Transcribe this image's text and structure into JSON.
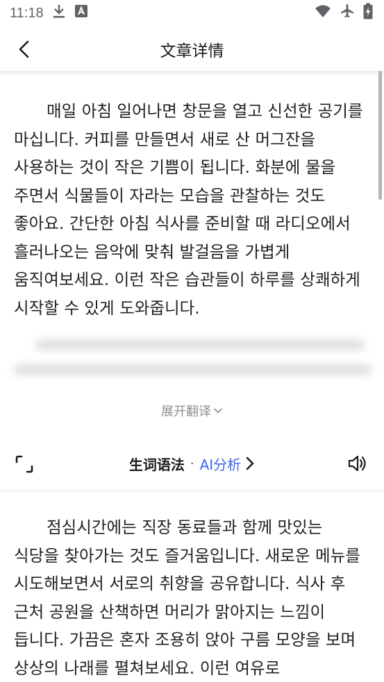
{
  "status_bar": {
    "time": "11:18",
    "icons_left": [
      "download-icon",
      "a-app-icon"
    ],
    "icons_right": [
      "wifi-icon",
      "airplane-mode-icon",
      "battery-charging-icon"
    ]
  },
  "header": {
    "title": "文章详情",
    "back_icon": "chevron-left-icon"
  },
  "article": {
    "paragraph_1": "매일 아침 일어나면 창문을 열고 신선한 공기를 마십니다. 커피를 만들면서 새로 산 머그잔을 사용하는 것이 작은 기쁨이 됩니다. 화분에 물을 주면서 식물들이 자라는 모습을 관찰하는 것도 좋아요. 간단한 아침 식사를 준비할 때 라디오에서 흘러나오는 음악에 맞춰 발걸음을 가볍게 움직여보세요. 이런 작은 습관들이 하루를 상쾌하게 시작할 수 있게 도와줍니다.",
    "paragraph_2": "점심시간에는 직장 동료들과 함께 맛있는 식당을 찾아가는 것도 즐거움입니다. 새로운 메뉴를 시도해보면서 서로의 취향을 공유합니다. 식사 후 근처 공원을 산책하면 머리가 맑아지는 느낌이 듭니다. 가끔은 혼자 조용히 앉아 구름 모양을 보며 상상의 나래를 펼쳐보세요. 이런 여유로"
  },
  "translation": {
    "expand_label": "展开翻译",
    "expand_icon": "chevron-down-icon"
  },
  "toolbar": {
    "vocab_label": "生词语法",
    "separator": "·",
    "ai_label": "AI分析",
    "left_icon": "scan-frame-icon",
    "right_icon": "speaker-icon"
  },
  "colors": {
    "accent": "#3a63f2",
    "text": "#222222",
    "muted": "#8e8e8e",
    "status_icons": "#5f6368"
  }
}
